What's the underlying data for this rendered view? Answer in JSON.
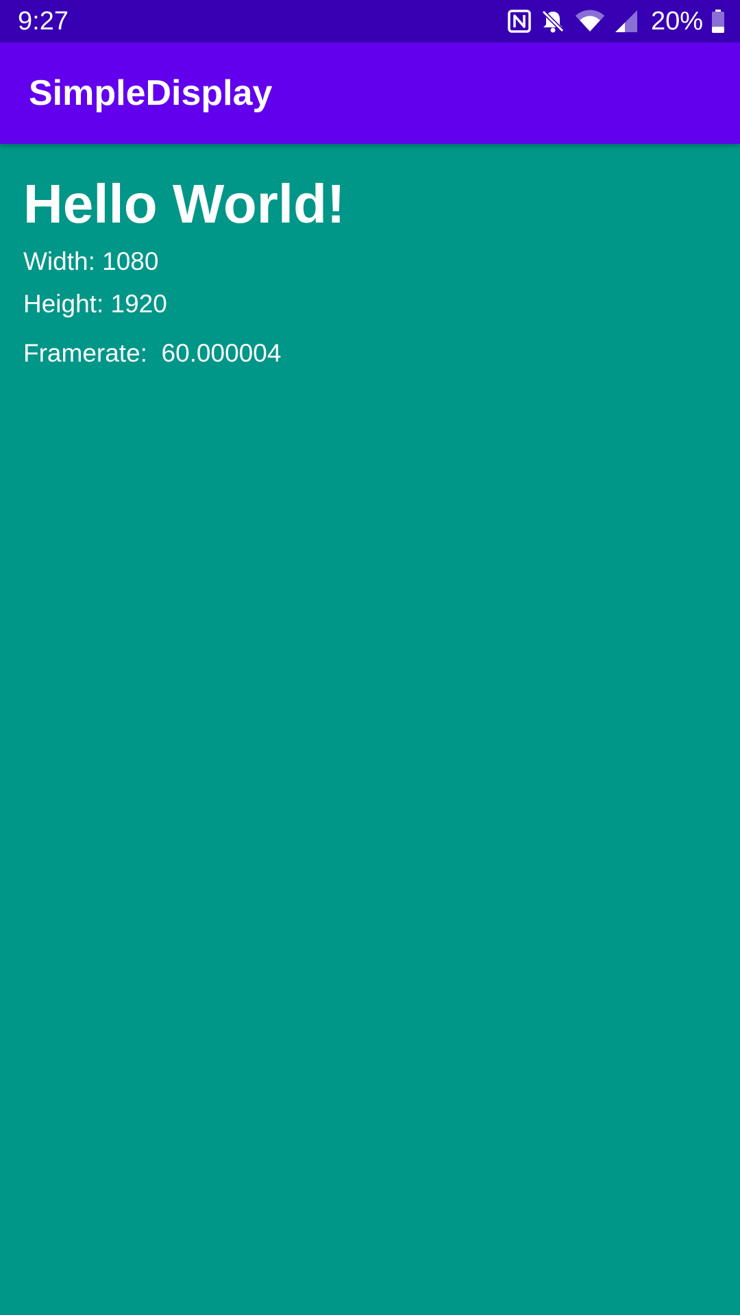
{
  "status_bar": {
    "time": "9:27",
    "icons": [
      "nfc-icon",
      "notifications-off-icon",
      "wifi-icon",
      "cell-signal-icon"
    ],
    "battery_percent": "20%",
    "background": "#3700B3"
  },
  "app_bar": {
    "title": "SimpleDisplay",
    "background": "#6200EE"
  },
  "content": {
    "heading": "Hello World!",
    "width_line": "Width: 1080",
    "height_line": "Height: 1920",
    "framerate_line": "Framerate:  60.000004",
    "background": "#009688"
  }
}
